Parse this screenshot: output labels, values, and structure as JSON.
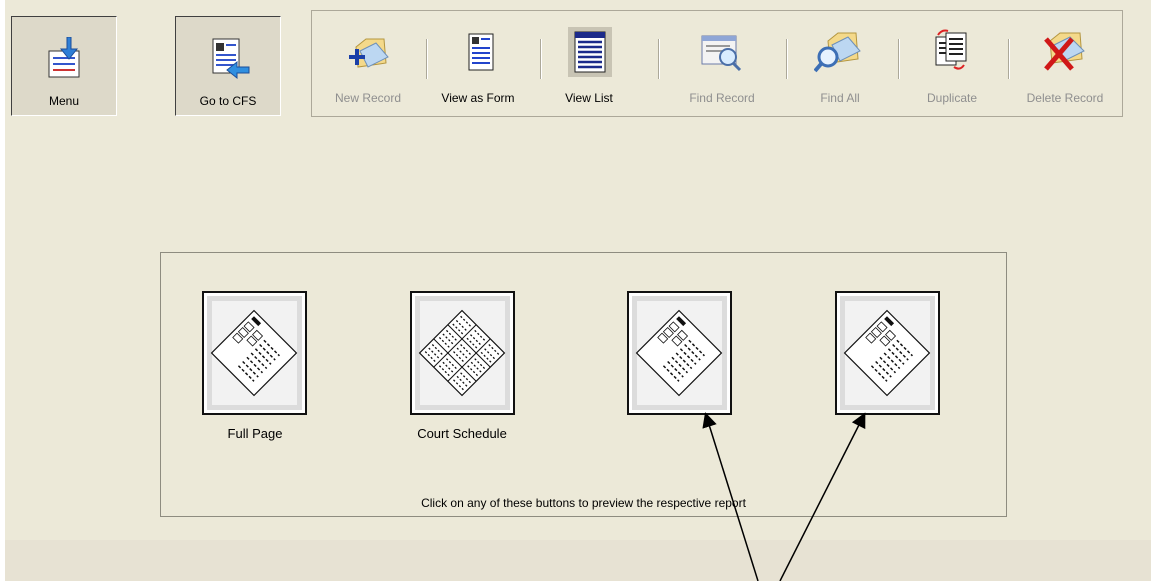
{
  "nav": {
    "menu_label": "Menu",
    "cfs_label": "Go to CFS"
  },
  "toolbar": {
    "items": [
      {
        "label": "New Record",
        "enabled": false,
        "icon": "new-record-folder-icon"
      },
      {
        "label": "View as Form",
        "enabled": true,
        "icon": "form-document-icon"
      },
      {
        "label": "View List",
        "enabled": true,
        "icon": "list-view-icon"
      },
      {
        "label": "Find Record",
        "enabled": false,
        "icon": "find-record-icon"
      },
      {
        "label": "Find All",
        "enabled": false,
        "icon": "find-all-magnifier-icon"
      },
      {
        "label": "Duplicate",
        "enabled": false,
        "icon": "duplicate-icon"
      },
      {
        "label": "Delete Record",
        "enabled": false,
        "icon": "delete-record-icon"
      }
    ]
  },
  "reports": {
    "buttons": [
      {
        "label": "Full Page",
        "icon": "report-preview-icon"
      },
      {
        "label": "Court Schedule",
        "icon": "schedule-preview-icon"
      },
      {
        "label": "",
        "icon": "report-preview-icon"
      },
      {
        "label": "",
        "icon": "report-preview-icon"
      }
    ],
    "hint": "Click on any of these buttons to preview the respective report"
  },
  "colors": {
    "background": "#ece9d8",
    "disabled_text": "#8f8f8f",
    "annotation_arrow": "#000000"
  }
}
